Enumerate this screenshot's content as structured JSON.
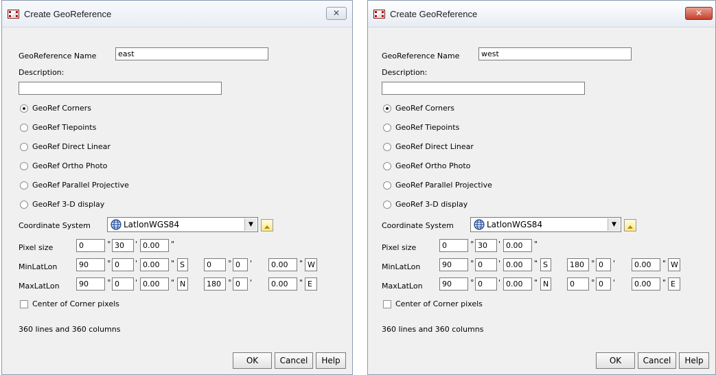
{
  "dialogs": [
    {
      "id": "east",
      "title": "Create GeoReference",
      "close_glyph": "✕",
      "name_label": "GeoReference Name",
      "name_value": "east",
      "description_label": "Description:",
      "description_value": "",
      "methods": [
        {
          "label": "GeoRef Corners",
          "checked": true
        },
        {
          "label": "GeoRef Tiepoints",
          "checked": false
        },
        {
          "label": "GeoRef Direct Linear",
          "checked": false
        },
        {
          "label": "GeoRef Ortho Photo",
          "checked": false
        },
        {
          "label": "GeoRef Parallel Projective",
          "checked": false
        },
        {
          "label": "GeoRef 3-D display",
          "checked": false
        }
      ],
      "coord_label": "Coordinate System",
      "coord_value": "LatlonWGS84",
      "pixel_label": "Pixel size",
      "pixel": {
        "deg": "0",
        "min": "30",
        "sec": "0.00"
      },
      "min_label": "MinLatLon",
      "min": {
        "lat_deg": "90",
        "lat_min": "0",
        "lat_sec": "0.00",
        "lat_hemi": "S",
        "lon_deg": "0",
        "lon_min": "0",
        "lon_sec": "0.00",
        "lon_hemi": "W"
      },
      "max_label": "MaxLatLon",
      "max": {
        "lat_deg": "90",
        "lat_min": "0",
        "lat_sec": "0.00",
        "lat_hemi": "N",
        "lon_deg": "180",
        "lon_min": "0",
        "lon_sec": "0.00",
        "lon_hemi": "E"
      },
      "center_label": "Center of Corner pixels",
      "center_checked": false,
      "info": "360 lines and 360 columns",
      "ok": "OK",
      "cancel": "Cancel",
      "help": "Help"
    },
    {
      "id": "west",
      "title": "Create GeoReference",
      "close_glyph": "✕",
      "name_label": "GeoReference Name",
      "name_value": "west",
      "description_label": "Description:",
      "description_value": "",
      "methods": [
        {
          "label": "GeoRef Corners",
          "checked": true
        },
        {
          "label": "GeoRef Tiepoints",
          "checked": false
        },
        {
          "label": "GeoRef Direct Linear",
          "checked": false
        },
        {
          "label": "GeoRef Ortho Photo",
          "checked": false
        },
        {
          "label": "GeoRef Parallel Projective",
          "checked": false
        },
        {
          "label": "GeoRef 3-D display",
          "checked": false
        }
      ],
      "coord_label": "Coordinate System",
      "coord_value": "LatlonWGS84",
      "pixel_label": "Pixel size",
      "pixel": {
        "deg": "0",
        "min": "30",
        "sec": "0.00"
      },
      "min_label": "MinLatLon",
      "min": {
        "lat_deg": "90",
        "lat_min": "0",
        "lat_sec": "0.00",
        "lat_hemi": "S",
        "lon_deg": "180",
        "lon_min": "0",
        "lon_sec": "0.00",
        "lon_hemi": "W"
      },
      "max_label": "MaxLatLon",
      "max": {
        "lat_deg": "90",
        "lat_min": "0",
        "lat_sec": "0.00",
        "lat_hemi": "N",
        "lon_deg": "0",
        "lon_min": "0",
        "lon_sec": "0.00",
        "lon_hemi": "E"
      },
      "center_label": "Center of Corner pixels",
      "center_checked": false,
      "info": "360 lines and 360 columns",
      "ok": "OK",
      "cancel": "Cancel",
      "help": "Help"
    }
  ],
  "symbols": {
    "deg": "°",
    "min": "'",
    "sec": "\""
  },
  "icons": {
    "app": "georef-app-icon",
    "close": "close-icon",
    "globe": "globe-icon",
    "dropdown": "chevron-down-icon",
    "picker": "triangle-up-icon"
  },
  "colors": {
    "window_bg": "#f0f0f0",
    "close_active": "#c4402b",
    "border": "#7a7a7a"
  }
}
